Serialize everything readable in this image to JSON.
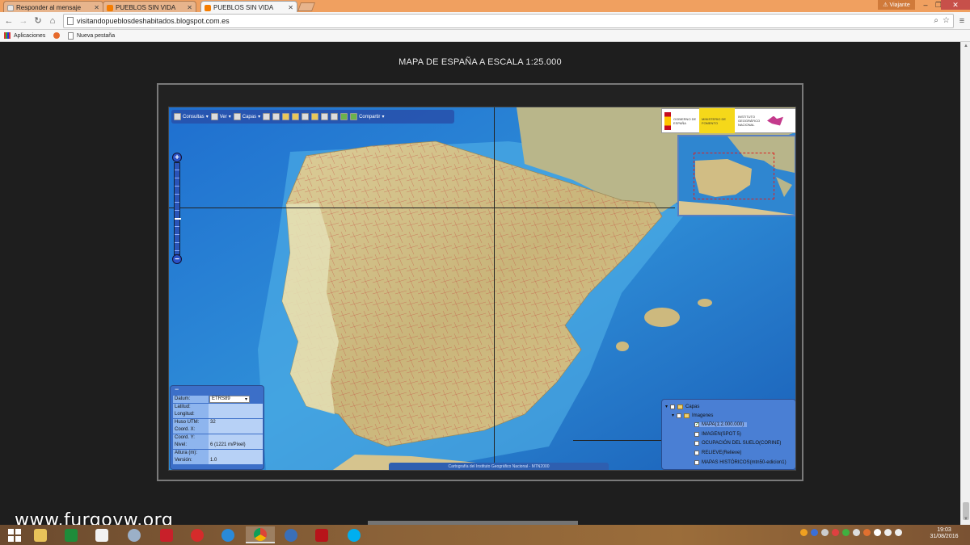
{
  "browser": {
    "tabs": [
      {
        "title": "Responder al mensaje",
        "active": false
      },
      {
        "title": "PUEBLOS SIN VIDA",
        "active": false
      },
      {
        "title": "PUEBLOS SIN VIDA",
        "active": true
      }
    ],
    "user_badge": "Viajante",
    "url": "visitandopueblosdeshabitados.blogspot.com.es",
    "bookmarks": [
      "Aplicaciones",
      "Nueva pestaña"
    ]
  },
  "page": {
    "title": "MAPA DE ESPAÑA A ESCALA 1:25.000"
  },
  "map": {
    "toolbar": {
      "consultas": "Consultas",
      "ver": "Ver",
      "capas": "Capas",
      "compartir": "Compartir"
    },
    "info_panel": {
      "collapse": "−",
      "rows": [
        {
          "key": "Datum:",
          "value": "ETRS89",
          "type": "select"
        },
        {
          "key": "Latitud:",
          "value": ""
        },
        {
          "key": "Longitud:",
          "value": ""
        },
        {
          "key": "Huso UTM:",
          "value": "32"
        },
        {
          "key": "Coord. X:",
          "value": ""
        },
        {
          "key": "Coord. Y:",
          "value": ""
        },
        {
          "key": "Nivel:",
          "value": "6 (1221 m/Pixel)"
        },
        {
          "key": "Altura (m):",
          "value": ""
        },
        {
          "key": "Versión:",
          "value": "1.0"
        }
      ]
    },
    "layers_panel": {
      "root": "Capas",
      "group": "Imagenes",
      "items": [
        {
          "label": "MAPA(1:2.000.000)",
          "checked": true
        },
        {
          "label": "IMAGEN(SPOT 5)",
          "checked": false
        },
        {
          "label": "OCUPACIÓN DEL SUELO(CORINE)",
          "checked": false
        },
        {
          "label": "RELIEVE(Relieve)",
          "checked": false
        },
        {
          "label": "MAPAS HISTÓRICOS(mtn50-edicion1)",
          "checked": false
        }
      ]
    },
    "credits": "Cartografía del Instituto Geográfico Nacional - MTN2000",
    "logo_text": {
      "gobierno": "GOBIERNO DE ESPAÑA",
      "ministerio": "MINISTERIO DE FOMENTO",
      "ign": "INSTITUTO GEOGRÁFICO NACIONAL"
    }
  },
  "overlay": {
    "watermark": "www.furgovw.org"
  },
  "taskbar": {
    "time": "19:03",
    "date": "31/08/2016"
  },
  "colors": {
    "tab_orange": "#f0a060",
    "map_panel_blue": "#3c6fc8",
    "sea_blue": "#2f8fd8",
    "land_tan": "#d9c08a"
  }
}
